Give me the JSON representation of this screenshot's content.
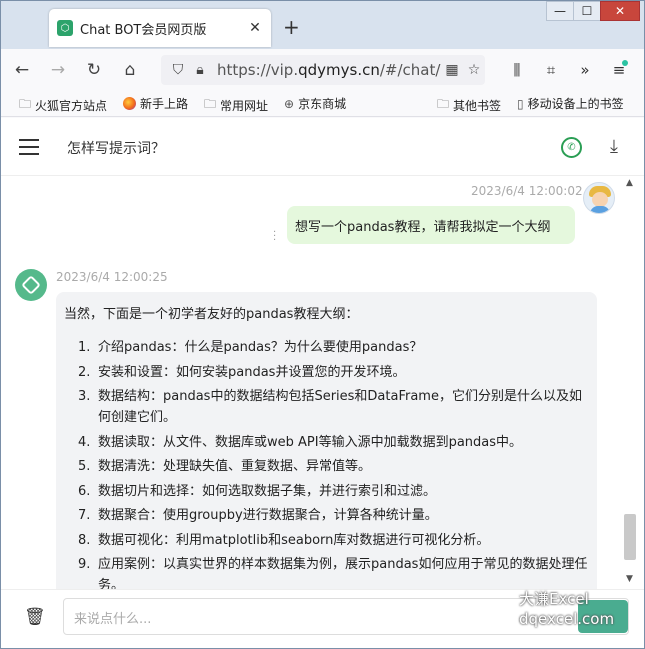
{
  "browser": {
    "tab_title": "Chat BOT会员网页版",
    "new_tab_icon": "plus-icon",
    "url_prefix": "https://vip.",
    "url_domain": "qdymys.cn",
    "url_rest": "/#/chat/",
    "window_controls": [
      "—",
      "☐",
      "✕"
    ]
  },
  "bookmarks": [
    {
      "label": "火狐官方站点",
      "icon": "folder-icon"
    },
    {
      "label": "新手上路",
      "icon": "firefox-icon"
    },
    {
      "label": "常用网址",
      "icon": "folder-icon"
    },
    {
      "label": "京东商城",
      "icon": "globe-icon"
    },
    {
      "label": "其他书签",
      "icon": "folder-icon"
    },
    {
      "label": "移动设备上的书签",
      "icon": "mobile-icon"
    }
  ],
  "page": {
    "title": "怎样写提示词？",
    "input_placeholder": "来说点什么..."
  },
  "messages": {
    "user": {
      "timestamp": "2023/6/4 12:00:02",
      "text": "想写一个pandas教程，请帮我拟定一个大纲"
    },
    "bot": {
      "timestamp": "2023/6/4 12:00:25",
      "intro": "当然，下面是一个初学者友好的pandas教程大纲：",
      "items": [
        {
          "num": "1.",
          "text": "介绍pandas：什么是pandas？为什么要使用pandas？"
        },
        {
          "num": "2.",
          "text": "安装和设置：如何安装pandas并设置您的开发环境。"
        },
        {
          "num": "3.",
          "text": "数据结构：pandas中的数据结构包括Series和DataFrame，它们分别是什么以及如何创建它们。"
        },
        {
          "num": "4.",
          "text": "数据读取：从文件、数据库或web API等输入源中加载数据到pandas中。"
        },
        {
          "num": "5.",
          "text": "数据清洗：处理缺失值、重复数据、异常值等。"
        },
        {
          "num": "6.",
          "text": "数据切片和选择：如何选取数据子集，并进行索引和过滤。"
        },
        {
          "num": "7.",
          "text": "数据聚合：使用groupby进行数据聚合，计算各种统计量。"
        },
        {
          "num": "8.",
          "text": "数据可视化：利用matplotlib和seaborn库对数据进行可视化分析。"
        },
        {
          "num": "9.",
          "text": "应用案例：以真实世界的样本数据集为例，展示pandas如何应用于常见的数据处理任务。"
        }
      ]
    }
  },
  "watermark": {
    "line1": "大谦Excel",
    "line2": "dqexcel.com"
  },
  "colors": {
    "accent": "#2a9e54",
    "user_bubble": "#e5f8dd",
    "bot_bubble": "#f2f3f5"
  }
}
